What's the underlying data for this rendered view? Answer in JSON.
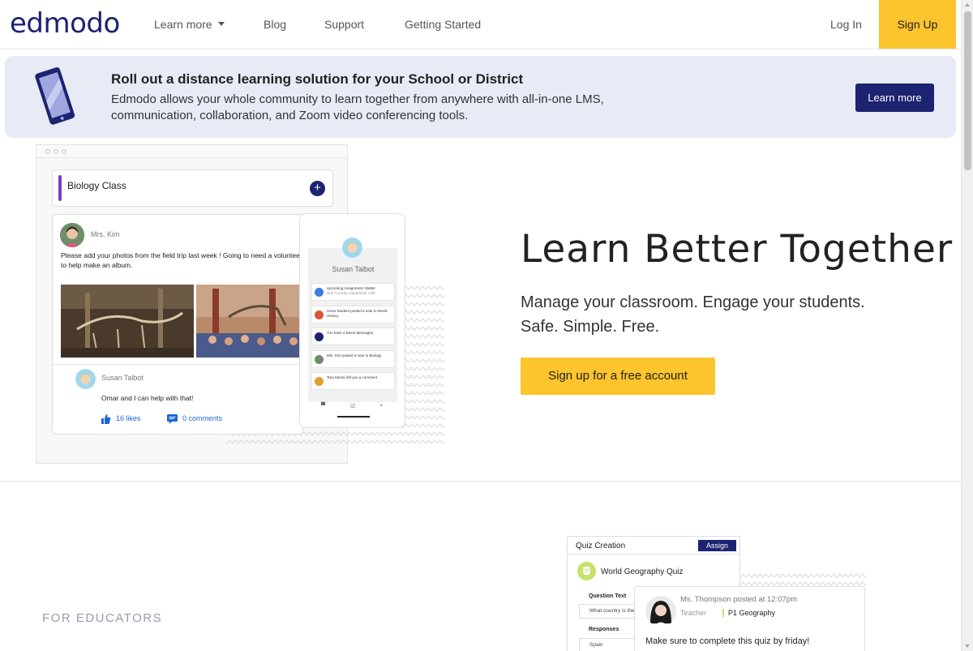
{
  "nav": {
    "logo": "edmodo",
    "learn_more": "Learn more",
    "blog": "Blog",
    "support": "Support",
    "getting_started": "Getting Started",
    "login": "Log In",
    "signup": "Sign Up"
  },
  "banner": {
    "title": "Roll out a distance learning solution for your School or District",
    "text": "Edmodo allows your whole community to learn together from anywhere with all-in-one LMS, communication, collaboration, and Zoom video conferencing tools.",
    "button": "Learn more"
  },
  "hero": {
    "title": "Learn Better Together",
    "subtitle_line1": "Manage your classroom. Engage your students.",
    "subtitle_line2": "Safe. Simple. Free.",
    "cta": "Sign up for a free account"
  },
  "mockup": {
    "class_title": "Biology Class",
    "post_author": "Mrs. Kim",
    "post_text": "Please add your photos from the field trip last week ! Going to need a volunteer to help make an album.",
    "comment_author": "Susan Talbot",
    "comment_text": "Omar and I can help with that!",
    "likes": "16 likes",
    "comments": "0 comments",
    "phone_name": "Susan Talbot",
    "notifications": [
      {
        "text": "Upcoming Assignment: Matter",
        "sub": "Due Tuesday September 14th"
      },
      {
        "text": "Omar Student posted a note to World History.",
        "sub": ""
      },
      {
        "text": "You have 4 Direct Messages",
        "sub": ""
      },
      {
        "text": "Mrs. Kim posted a note to Biology",
        "sub": ""
      },
      {
        "text": "Tara Moore left you a comment",
        "sub": ""
      }
    ]
  },
  "educators": {
    "label": "FOR EDUCATORS"
  },
  "quiz": {
    "title": "Quiz Creation",
    "assign": "Assign",
    "name": "World Geography Quiz",
    "question_label": "Question Text",
    "question_value": "What country is the",
    "responses_label": "Responses",
    "response_value": "Spain",
    "post_author": "Ms. Thompson posted at 12:07pm",
    "post_role": "Teacher",
    "post_class": "P1 Geography",
    "post_text": "Make sure to complete this quiz by friday!"
  },
  "colors": {
    "brand_navy": "#1c2370",
    "accent_yellow": "#fcc42d",
    "banner_bg": "#e8eaf6"
  }
}
